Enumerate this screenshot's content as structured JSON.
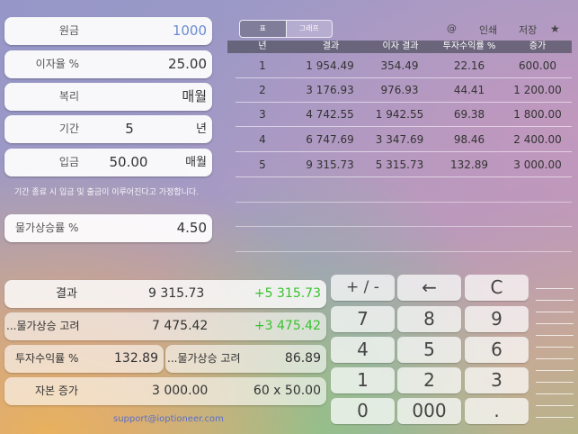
{
  "inputs": {
    "principal": {
      "label": "원금",
      "value": "1000"
    },
    "rate": {
      "label": "이자율 %",
      "value": "25.00"
    },
    "compound": {
      "label": "복리",
      "value": "매월"
    },
    "period": {
      "label": "기간",
      "value": "5",
      "unit": "년"
    },
    "deposit": {
      "label": "입금",
      "value": "50.00",
      "unit": "매월"
    },
    "note": "기간 종료 시 입금 및 출금이 이루어진다고 가정합니다.",
    "inflation": {
      "label": "물가상승률 %",
      "value": "4.50"
    }
  },
  "view_tabs": [
    "표",
    "그래프"
  ],
  "toolbar": {
    "at": "@",
    "print": "인쇄",
    "save": "저장",
    "star": "★"
  },
  "table": {
    "headers": [
      "년",
      "결과",
      "이자 결과",
      "투자수익률 %",
      "증가"
    ],
    "rows": [
      [
        "1",
        "1 954.49",
        "354.49",
        "22.16",
        "600.00"
      ],
      [
        "2",
        "3 176.93",
        "976.93",
        "44.41",
        "1 200.00"
      ],
      [
        "3",
        "4 742.55",
        "1 942.55",
        "69.38",
        "1 800.00"
      ],
      [
        "4",
        "6 747.69",
        "3 347.69",
        "98.46",
        "2 400.00"
      ],
      [
        "5",
        "9 315.73",
        "5 315.73",
        "132.89",
        "3 000.00"
      ]
    ]
  },
  "results": {
    "result": {
      "label": "결과",
      "value": "9 315.73",
      "delta": "+5 315.73"
    },
    "inflation_adj": {
      "label": "...물가상승 고려",
      "value": "7 475.42",
      "delta": "+3 475.42"
    },
    "roi": {
      "label": "투자수익률 %",
      "value": "132.89"
    },
    "roi_inflation": {
      "label": "...물가상승 고려",
      "value": "86.89"
    },
    "capital": {
      "label": "자본 증가",
      "value": "3 000.00",
      "detail": "60 x 50.00"
    }
  },
  "support": "support@ioptioneer.com",
  "keypad": [
    [
      "+ / -",
      "←",
      "C"
    ],
    [
      "7",
      "8",
      "9"
    ],
    [
      "4",
      "5",
      "6"
    ],
    [
      "1",
      "2",
      "3"
    ],
    [
      "0",
      "000",
      "."
    ]
  ]
}
